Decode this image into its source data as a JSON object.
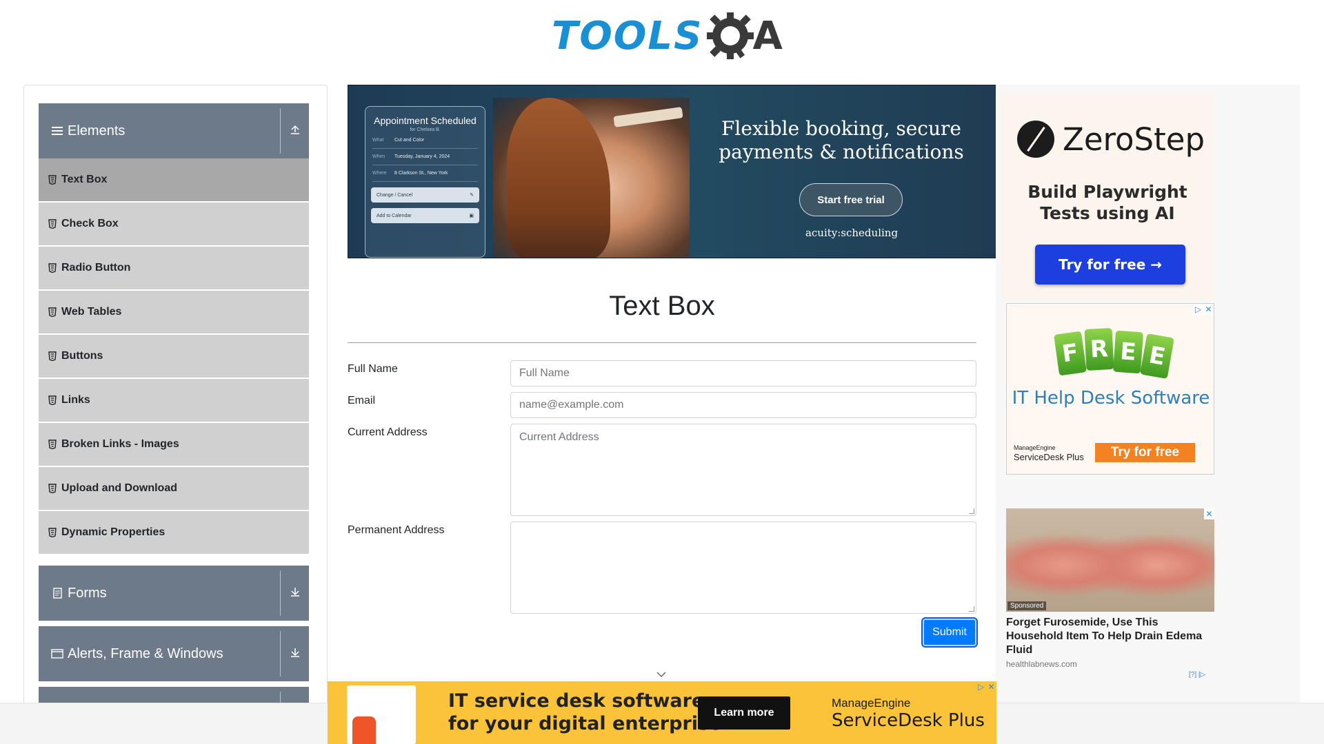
{
  "header": {
    "logo_left": "TOOLS",
    "logo_right": "A"
  },
  "sidebar": {
    "elements_label": "Elements",
    "items": [
      {
        "label": "Text Box"
      },
      {
        "label": "Check Box"
      },
      {
        "label": "Radio Button"
      },
      {
        "label": "Web Tables"
      },
      {
        "label": "Buttons"
      },
      {
        "label": "Links"
      },
      {
        "label": "Broken Links - Images"
      },
      {
        "label": "Upload and Download"
      },
      {
        "label": "Dynamic Properties"
      }
    ],
    "forms_label": "Forms",
    "alerts_label": "Alerts, Frame & Windows"
  },
  "top_ad": {
    "card_title": "Appointment Scheduled",
    "card_sub": "for Chelsea B.",
    "rows": [
      {
        "k": "What",
        "v": "Cut and Color"
      },
      {
        "k": "When",
        "v": "Tuesday, January 4, 2024"
      },
      {
        "k": "Where",
        "v": "8 Clarkson St., New York"
      }
    ],
    "btn1": "Change / Cancel",
    "btn2": "Add to Calendar",
    "headline": "Flexible booking, secure payments & notifications",
    "cta": "Start free trial",
    "brand": "acuity:scheduling"
  },
  "main": {
    "title": "Text Box",
    "full_name_label": "Full Name",
    "full_name_placeholder": "Full Name",
    "email_label": "Email",
    "email_placeholder": "name@example.com",
    "current_address_label": "Current Address",
    "current_address_placeholder": "Current Address",
    "permanent_address_label": "Permanent Address",
    "submit_label": "Submit"
  },
  "right_ads": {
    "zerostep_name": "ZeroStep",
    "zerostep_tagline": "Build Playwright Tests using AI",
    "zerostep_button": "Try for free →",
    "helpdesk_free": [
      "F",
      "R",
      "E",
      "E"
    ],
    "helpdesk_title": "IT Help Desk Software",
    "helpdesk_brand_small": "ManageEngine",
    "helpdesk_brand": "ServiceDesk Plus",
    "helpdesk_button": "Try for free",
    "sponsored": "Sponsored",
    "feet_headline": "Forget Furosemide, Use This Household Item To Help Drain Edema Fluid",
    "feet_source": "healthlabnews.com",
    "adchoices": "[?] |▷"
  },
  "bottom_ad": {
    "line1": "IT service desk software",
    "line2": "for your digital enterprise",
    "button": "Learn more",
    "brand_small": "ManageEngine",
    "brand": "ServiceDesk Plus"
  },
  "colors": {
    "accent": "#007bff",
    "sidebar_header": "#6d7a8a",
    "sidebar_item": "#d0d0d0",
    "sidebar_active": "#a8a8a8",
    "logo_blue": "#1a8fd3"
  }
}
